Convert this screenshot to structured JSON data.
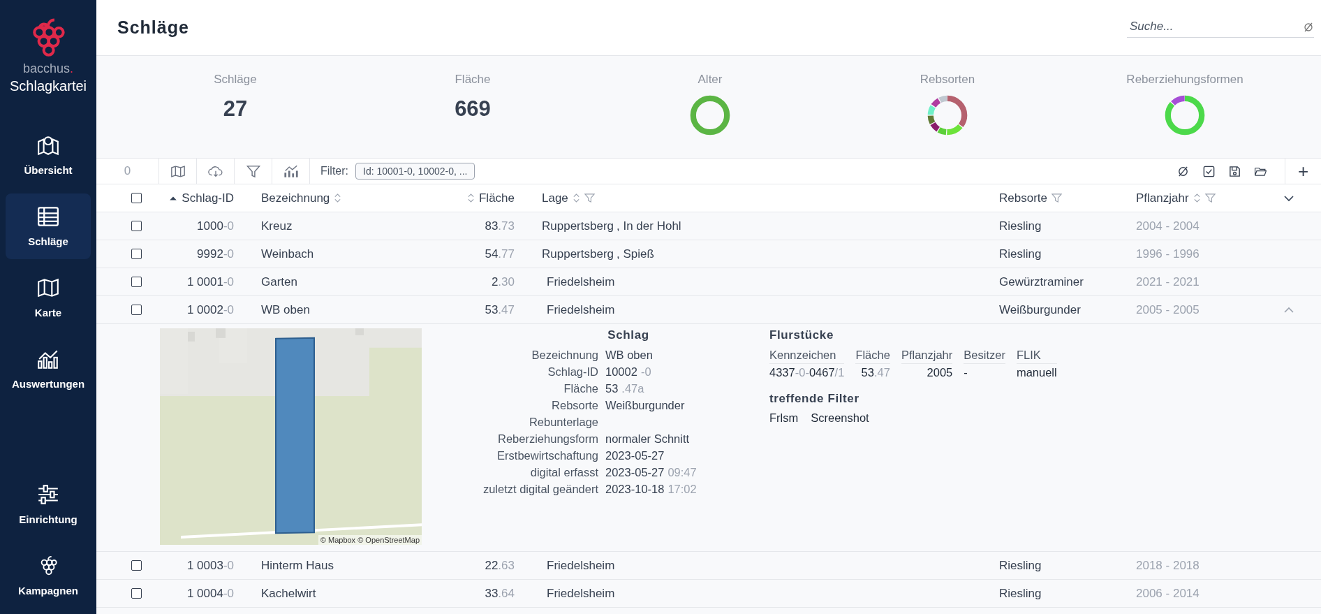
{
  "sidebar": {
    "brand": {
      "name": "bacchus",
      "mark": ".",
      "product": "Schlagkartei"
    },
    "items": [
      {
        "label": "Übersicht",
        "kind": "overview",
        "selected": false
      },
      {
        "label": "Schläge",
        "kind": "table",
        "selected": true
      },
      {
        "label": "Karte",
        "kind": "map",
        "selected": false
      },
      {
        "label": "Auswertungen",
        "kind": "chart",
        "selected": false
      }
    ],
    "bottom_items": [
      {
        "label": "Einrichtung",
        "kind": "settings",
        "selected": false
      },
      {
        "label": "Kampagnen",
        "kind": "grapes",
        "selected": false
      }
    ]
  },
  "header": {
    "title": "Schläge",
    "search": {
      "placeholder": "Suche..."
    }
  },
  "stats": [
    {
      "label": "Schläge",
      "kind": "number",
      "value": "27"
    },
    {
      "label": "Fläche",
      "kind": "number",
      "value": "669"
    },
    {
      "label": "Alter",
      "kind": "donut"
    },
    {
      "label": "Rebsorten",
      "kind": "donut"
    },
    {
      "label": "Reberziehungsformen",
      "kind": "donut"
    }
  ],
  "toolbar": {
    "count": "0",
    "left_tools": [
      {
        "kind": "map"
      },
      {
        "kind": "download"
      },
      {
        "kind": "filter"
      },
      {
        "kind": "chart"
      }
    ],
    "filter_label": "Filter:",
    "filter_chip": "Id: 10001-0, 10002-0, ...",
    "right_tools": [
      {
        "kind": "clear"
      },
      {
        "kind": "check"
      },
      {
        "kind": "save"
      },
      {
        "kind": "folder"
      }
    ],
    "add": "+"
  },
  "table": {
    "select_all": {
      "checked": false
    },
    "all_expanded": false,
    "columns": [
      {
        "label": "Schlag-ID",
        "sortable": true,
        "sorted": true,
        "filter": false
      },
      {
        "label": "Bezeichnung",
        "sortable": true,
        "sorted": false,
        "filter": false
      },
      {
        "label": "Fläche",
        "sortable": true,
        "sorted": false,
        "filter": false
      },
      {
        "label": "Lage",
        "sortable": true,
        "sorted": false,
        "filter": true
      },
      {
        "label": "Rebsorte",
        "sortable": false,
        "filter": true
      },
      {
        "label": "Pflanzjahr",
        "sortable": true,
        "sorted": false,
        "filter": true
      }
    ],
    "rows": [
      {
        "checked": false,
        "expanded": false,
        "id": [
          "1000",
          "-0"
        ],
        "name": "Kreuz",
        "area": [
          "83",
          ".73"
        ],
        "lage": [
          "Ruppertsberg",
          ", In der Hohl"
        ],
        "variety": "Riesling",
        "years": "2004 - 2004"
      },
      {
        "checked": false,
        "expanded": false,
        "id": [
          "9992",
          "-0"
        ],
        "name": "Weinbach",
        "area": [
          "54",
          ".77"
        ],
        "lage": [
          "Ruppertsberg",
          ", Spieß"
        ],
        "variety": "Riesling",
        "years": "1996 - 1996"
      },
      {
        "checked": false,
        "expanded": false,
        "id": [
          "1 0001",
          "-0"
        ],
        "name": "Garten",
        "area": [
          "2",
          ".30"
        ],
        "lage": [
          "Friedelsheim"
        ],
        "variety": "Gewürztraminer",
        "years": "2021 - 2021"
      },
      {
        "checked": false,
        "expanded": true,
        "id": [
          "1 0002",
          "-0"
        ],
        "name": "WB oben",
        "area": [
          "53",
          ".47"
        ],
        "lage": [
          "Friedelsheim"
        ],
        "variety": "Weißburgunder",
        "years": "2005 - 2005",
        "detail": {
          "map_attribution": "© Mapbox © OpenStreetMap",
          "schlag_title": "Schlag",
          "fields": [
            {
              "label": "Bezeichnung",
              "value": [
                "WB oben"
              ]
            },
            {
              "label": "Schlag-ID",
              "value": [
                "10002",
                "-0"
              ]
            },
            {
              "label": "Fläche",
              "value": [
                "53",
                ".47a"
              ]
            },
            {
              "label": "Rebsorte",
              "value": [
                "Weißburgunder"
              ]
            },
            {
              "label": "Rebunterlage"
            },
            {
              "label": "Reberziehungsform",
              "value": [
                "normaler Schnitt"
              ]
            },
            {
              "label": "Erstbewirtschaftung",
              "value": [
                "2023-05-27"
              ]
            },
            {
              "label": "digital erfasst",
              "value": [
                "2023-05-27",
                "09:47"
              ]
            },
            {
              "label": "zuletzt digital geändert",
              "value": [
                "2023-10-18",
                "17:02"
              ]
            }
          ],
          "parcels_title": "Flurstücke",
          "parcel_columns": [
            "Kennzeichen",
            "Fläche",
            "Pflanzjahr",
            "Besitzer",
            "FLIK"
          ],
          "parcel_rows": [
            [
              [
                "4337",
                "-0-",
                "0467",
                "/1"
              ],
              [
                "53",
                ".47"
              ],
              [
                "2005"
              ],
              [
                "-"
              ],
              [
                "manuell"
              ]
            ]
          ],
          "filters_title": "treffende Filter",
          "filters": [
            "Frlsm",
            "Screenshot"
          ]
        }
      },
      {
        "checked": false,
        "expanded": false,
        "id": [
          "1 0003",
          "-0"
        ],
        "name": "Hinterm Haus",
        "area": [
          "22",
          ".63"
        ],
        "lage": [
          "Friedelsheim"
        ],
        "variety": "Riesling",
        "years": "2018 - 2018"
      },
      {
        "checked": false,
        "expanded": false,
        "id": [
          "1 0004",
          "-0"
        ],
        "name": "Kachelwirt",
        "area": [
          "33",
          ".64"
        ],
        "lage": [
          "Friedelsheim"
        ],
        "variety": "Riesling",
        "years": "2006 - 2014"
      }
    ]
  }
}
